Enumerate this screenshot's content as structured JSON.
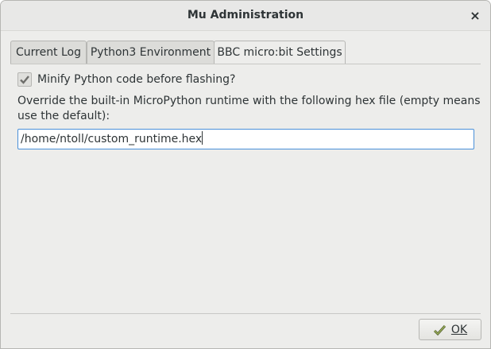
{
  "window": {
    "title": "Mu Administration",
    "close_glyph": "×"
  },
  "tabs": [
    {
      "label": "Current Log",
      "active": false
    },
    {
      "label": "Python3 Environment",
      "active": false
    },
    {
      "label": "BBC micro:bit Settings",
      "active": true
    }
  ],
  "settings": {
    "minify_label": "Minify Python code before flashing?",
    "minify_checked": true,
    "override_description": "Override the built-in MicroPython runtime with the following hex file (empty means use the default):",
    "hex_path": "/home/ntoll/custom_runtime.hex"
  },
  "footer": {
    "ok_label": "OK",
    "ok_icon": "checkmark-icon"
  },
  "colors": {
    "focus_border": "#4a90d9",
    "checkmark": "#6e6e6b"
  }
}
